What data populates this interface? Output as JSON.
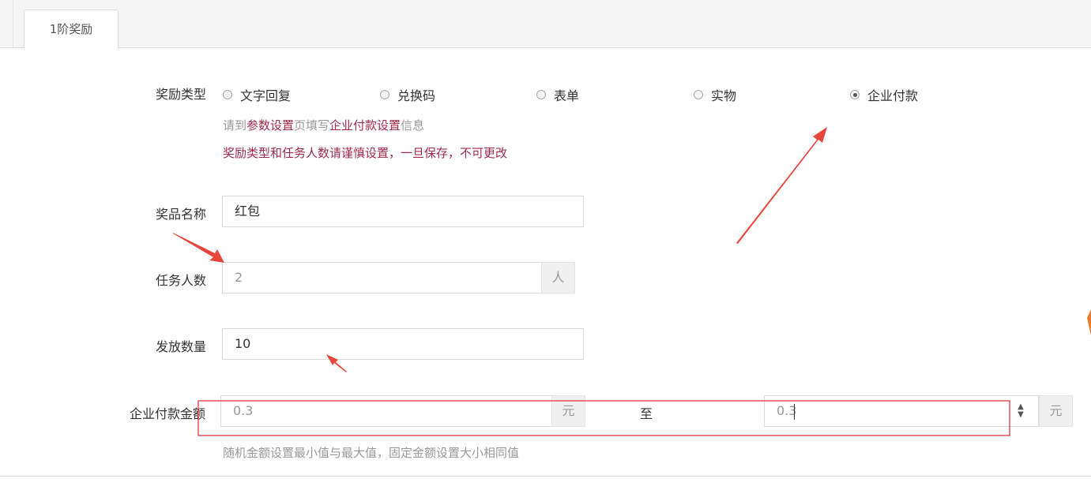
{
  "tabs": [
    {
      "label": "1阶奖励"
    }
  ],
  "form": {
    "reward_type": {
      "label": "奖励类型",
      "options": [
        "文字回复",
        "兑换码",
        "表单",
        "实物",
        "企业付款"
      ],
      "selected": "企业付款"
    },
    "hint": {
      "p1": "请到",
      "link1": "参数设置",
      "p2": "页填写",
      "link2": "企业付款设置",
      "p3": "信息"
    },
    "warning": "奖励类型和任务人数请谨慎设置，一旦保存，不可更改",
    "prize_name": {
      "label": "奖品名称",
      "value": "红包"
    },
    "task_count": {
      "label": "任务人数",
      "value": "2",
      "unit": "人"
    },
    "issue_count": {
      "label": "发放数量",
      "value": "10"
    },
    "payment_amount": {
      "label": "企业付款金额",
      "min_value": "0.3",
      "min_unit": "元",
      "separator": "至",
      "max_value": "0.3",
      "max_unit": "元",
      "hint": "随机金额设置最小值与最大值，固定金额设置大小相同值"
    }
  },
  "annotations": {
    "color": "#e8453c",
    "box_color": "#d9272e"
  }
}
